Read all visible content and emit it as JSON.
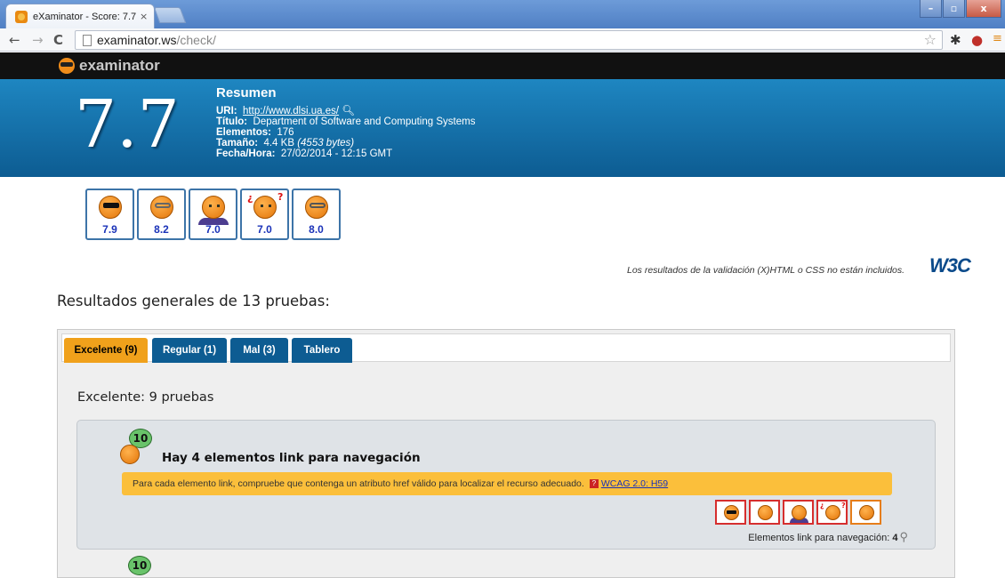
{
  "browser": {
    "tab_title": "eXaminator - Score: 7.7",
    "tab_close": "×",
    "url_host": "examinator.ws",
    "url_path": "/check/",
    "window_minimize": "–",
    "window_maximize": "▫",
    "window_close": "x"
  },
  "site": {
    "logo_text": "examinator"
  },
  "banner": {
    "score": "7.7",
    "title": "Resumen",
    "uri_label": "URI:",
    "uri_value": "http://www.dlsi.ua.es/",
    "title_label": "Título:",
    "title_value": "Department of Software and Computing Systems",
    "elements_label": "Elementos:",
    "elements_value": "176",
    "size_label": "Tamaño:",
    "size_value": "4.4 KB",
    "size_bytes": "(4553 bytes)",
    "date_label": "Fecha/Hora:",
    "date_value": "27/02/2014 - 12:15 GMT"
  },
  "profiles": [
    {
      "icon": "sunglasses-face-icon",
      "score": "7.9"
    },
    {
      "icon": "glasses-face-icon",
      "score": "8.2"
    },
    {
      "icon": "person-face-icon",
      "score": "7.0"
    },
    {
      "icon": "confused-face-icon",
      "score": "7.0"
    },
    {
      "icon": "old-face-icon",
      "score": "8.0"
    }
  ],
  "w3c_note": "Los resultados de la validación (X)HTML o CSS no están incluidos.",
  "w3c_logo": "W3C",
  "results_heading": "Resultados generales de 13 pruebas:",
  "tabs": [
    {
      "label": "Excelente (9)",
      "active": true
    },
    {
      "label": "Regular (1)",
      "active": false
    },
    {
      "label": "Mal (3)",
      "active": false
    },
    {
      "label": "Tablero",
      "active": false
    }
  ],
  "panel_subtitle": "Excelente: 9 pruebas",
  "test": {
    "badge_score": "10",
    "title": "Hay 4 elementos link para navegación",
    "hint": "Para cada elemento link, compruebe que contenga un atributo href válido para localizar el recurso adecuado.",
    "help_mark": "?",
    "link": "WCAG 2.0: H59",
    "count_label": "Elementos link para navegación:",
    "count_value": "4"
  },
  "next_badge_score": "10",
  "colors": {
    "banner_blue": "#0d5c92",
    "active_tab": "#f0a11b",
    "hint_bg": "#fbbf3b",
    "score_blue": "#1a32b8"
  }
}
